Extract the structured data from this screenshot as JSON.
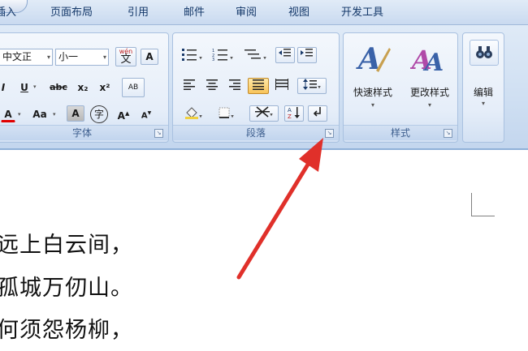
{
  "menu": {
    "tabs": [
      "插入",
      "页面布局",
      "引用",
      "邮件",
      "审阅",
      "视图",
      "开发工具"
    ]
  },
  "font_group": {
    "title": "字体",
    "font_name": "中文正",
    "font_size": "小一",
    "phonetic_label": "wén",
    "phonetic_char": "文",
    "border_char": "A",
    "underline": "U",
    "strikethrough": "abc",
    "subscript": "x₂",
    "superscript": "x²",
    "clear_format_label": "AB",
    "font_color_char": "A",
    "change_case": "Aa",
    "char_shading": "A",
    "enclose_char": "字",
    "grow_font": "A",
    "shrink_font": "A",
    "italic_stub": "I"
  },
  "paragraph_group": {
    "title": "段落"
  },
  "styles_group": {
    "title": "样式",
    "quick_styles": "快速样式",
    "change_styles": "更改样式"
  },
  "editing_group": {
    "title": "编辑"
  },
  "document": {
    "lines": [
      "远上白云间，",
      "孤城万仞山。",
      "何须怨杨柳，"
    ]
  },
  "colors": {
    "accent_red": "#e0302a",
    "ribbon_blue": "#cfdff2",
    "font_color_underline": "#e00000"
  }
}
